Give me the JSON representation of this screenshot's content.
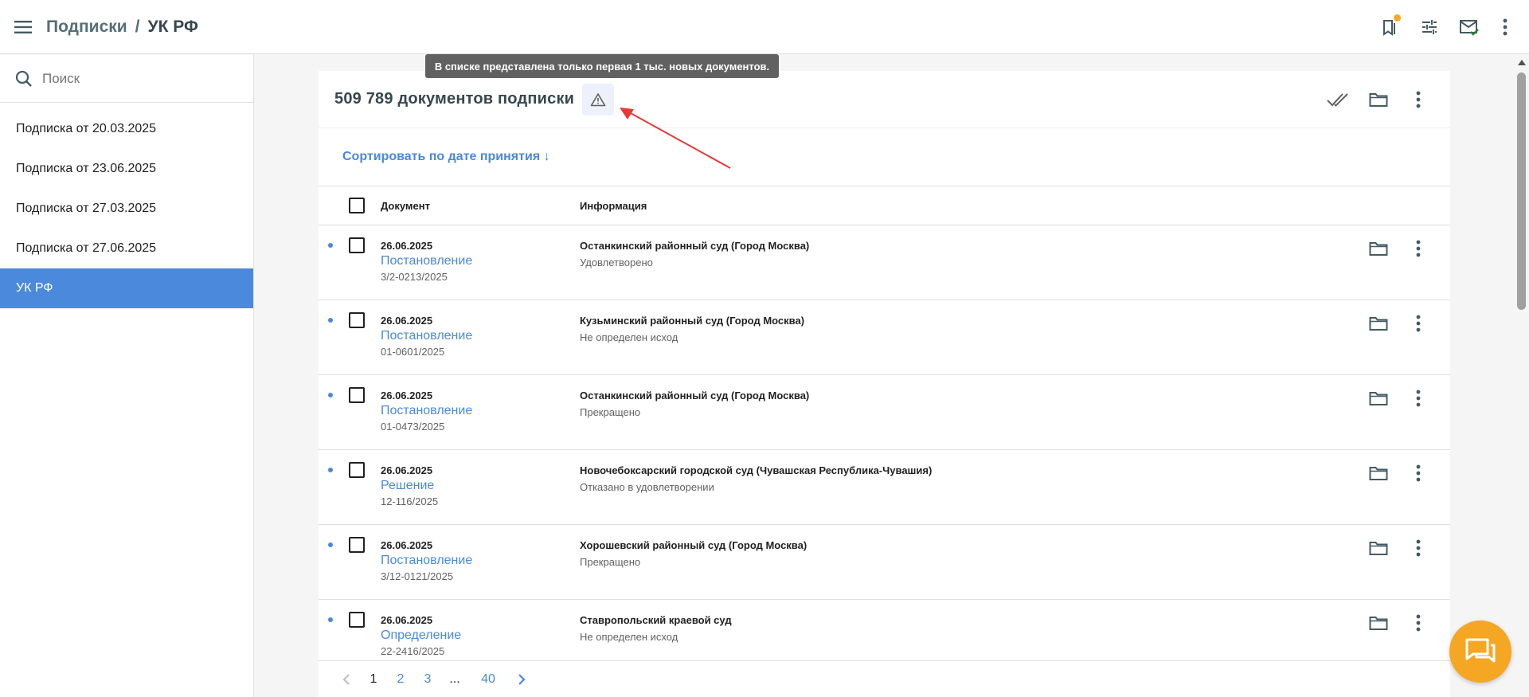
{
  "header": {
    "breadcrumb_root": "Подписки",
    "breadcrumb_sep": "/",
    "breadcrumb_current": "УК РФ"
  },
  "sidebar": {
    "search_placeholder": "Поиск",
    "items": [
      {
        "label": "Подписка от 20.03.2025",
        "active": false
      },
      {
        "label": "Подписка от 23.06.2025",
        "active": false
      },
      {
        "label": "Подписка от 27.03.2025",
        "active": false
      },
      {
        "label": "Подписка от 27.06.2025",
        "active": false
      },
      {
        "label": "УК РФ",
        "active": true
      }
    ]
  },
  "tooltip": "В списке представлена только первая 1 тыс. новых документов.",
  "main": {
    "title": "509 789 документов подписки",
    "sort_label": "Сортировать по дате принятия ↓",
    "columns": [
      "Документ",
      "Информация"
    ],
    "rows": [
      {
        "date": "26.06.2025",
        "type": "Постановление",
        "number": "3/2-0213/2025",
        "court": "Останкинский районный суд (Город Москва)",
        "result": "Удовлетворено"
      },
      {
        "date": "26.06.2025",
        "type": "Постановление",
        "number": "01-0601/2025",
        "court": "Кузьминский районный суд (Город Москва)",
        "result": "Не определен исход"
      },
      {
        "date": "26.06.2025",
        "type": "Постановление",
        "number": "01-0473/2025",
        "court": "Останкинский районный суд (Город Москва)",
        "result": "Прекращено"
      },
      {
        "date": "26.06.2025",
        "type": "Решение",
        "number": "12-116/2025",
        "court": "Новочебоксарский городской суд (Чувашская Республика-Чувашия)",
        "result": "Отказано в удовлетворении"
      },
      {
        "date": "26.06.2025",
        "type": "Постановление",
        "number": "3/12-0121/2025",
        "court": "Хорошевский районный суд (Город Москва)",
        "result": "Прекращено"
      },
      {
        "date": "26.06.2025",
        "type": "Определение",
        "number": "22-2416/2025",
        "court": "Ставропольский краевой суд",
        "result": "Не определен исход"
      }
    ]
  },
  "pagination": {
    "pages": [
      "1",
      "2",
      "3"
    ],
    "ellipsis": "...",
    "last": "40",
    "current": "1"
  },
  "colors": {
    "accent": "#4a89dc",
    "fab": "#f5a623",
    "annotation": "#e53935",
    "notification": "#f9a825"
  }
}
